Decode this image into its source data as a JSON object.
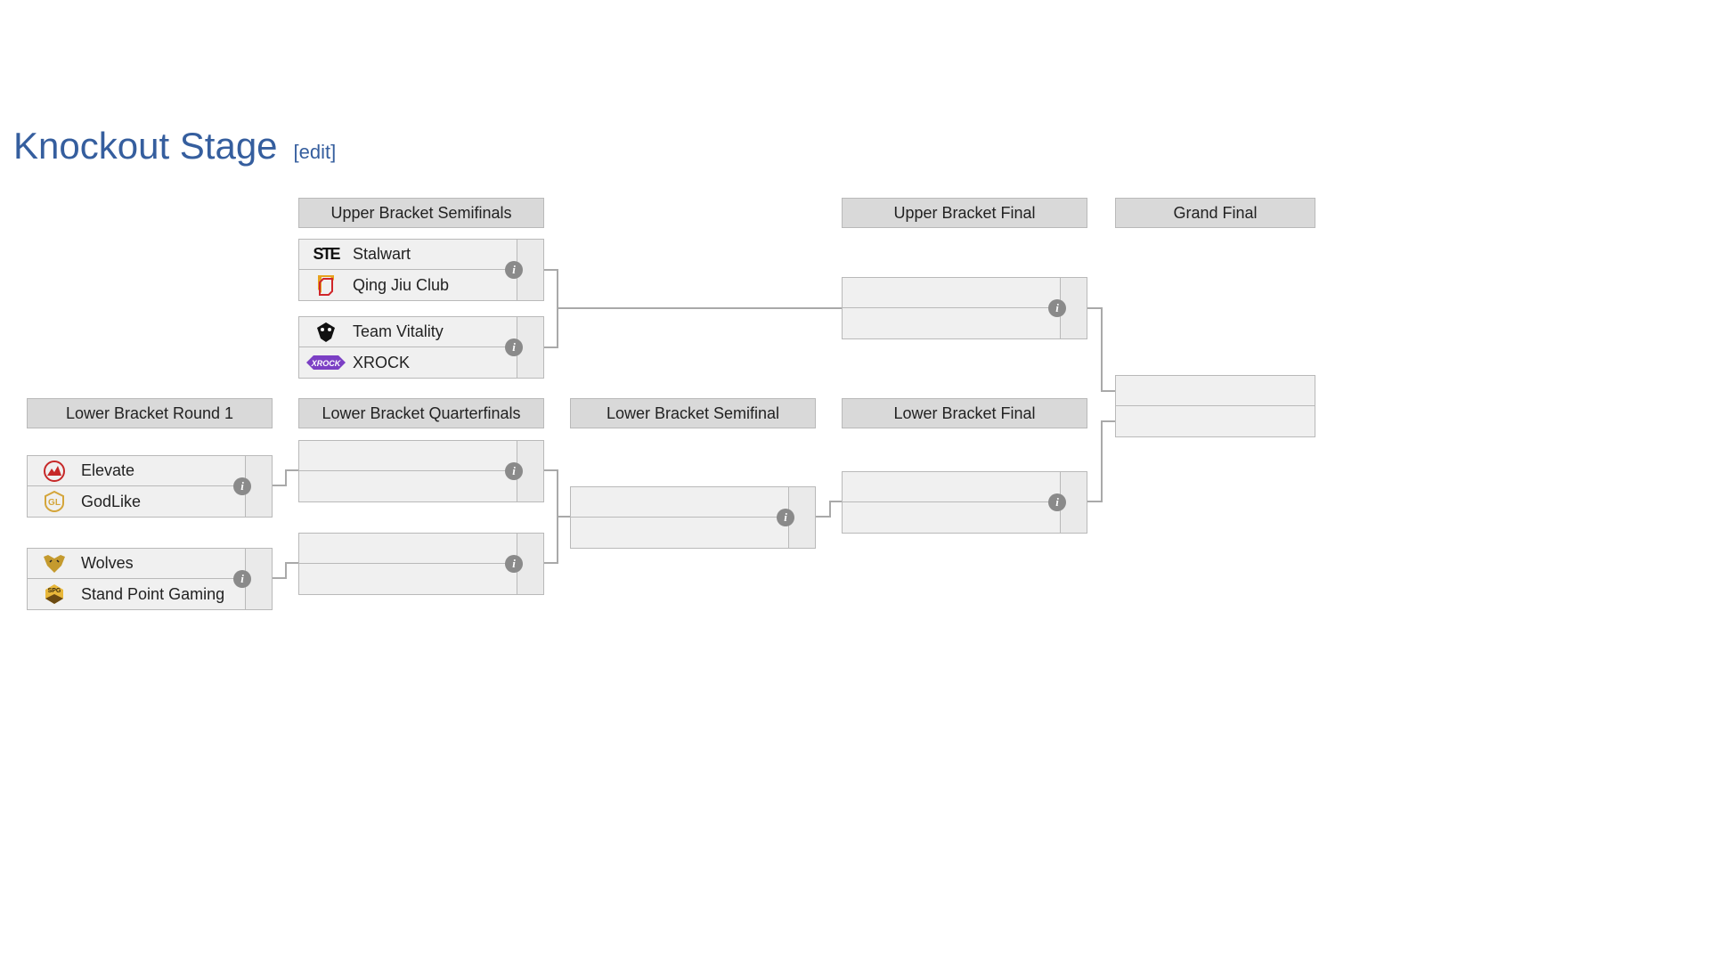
{
  "heading": {
    "title": "Knockout Stage",
    "edit": "[edit]"
  },
  "rounds": {
    "ubsf": "Upper Bracket Semifinals",
    "ubf": "Upper Bracket Final",
    "gf": "Grand Final",
    "lbr1": "Lower Bracket Round 1",
    "lbqf": "Lower Bracket Quarterfinals",
    "lbsf": "Lower Bracket Semifinal",
    "lbf": "Lower Bracket Final"
  },
  "teams": {
    "stalwart": "Stalwart",
    "qjc": "Qing Jiu Club",
    "vitality": "Team Vitality",
    "xrock": "XROCK",
    "elevate": "Elevate",
    "godlike": "GodLike",
    "wolves": "Wolves",
    "spg": "Stand Point Gaming"
  },
  "info_glyph": "i"
}
